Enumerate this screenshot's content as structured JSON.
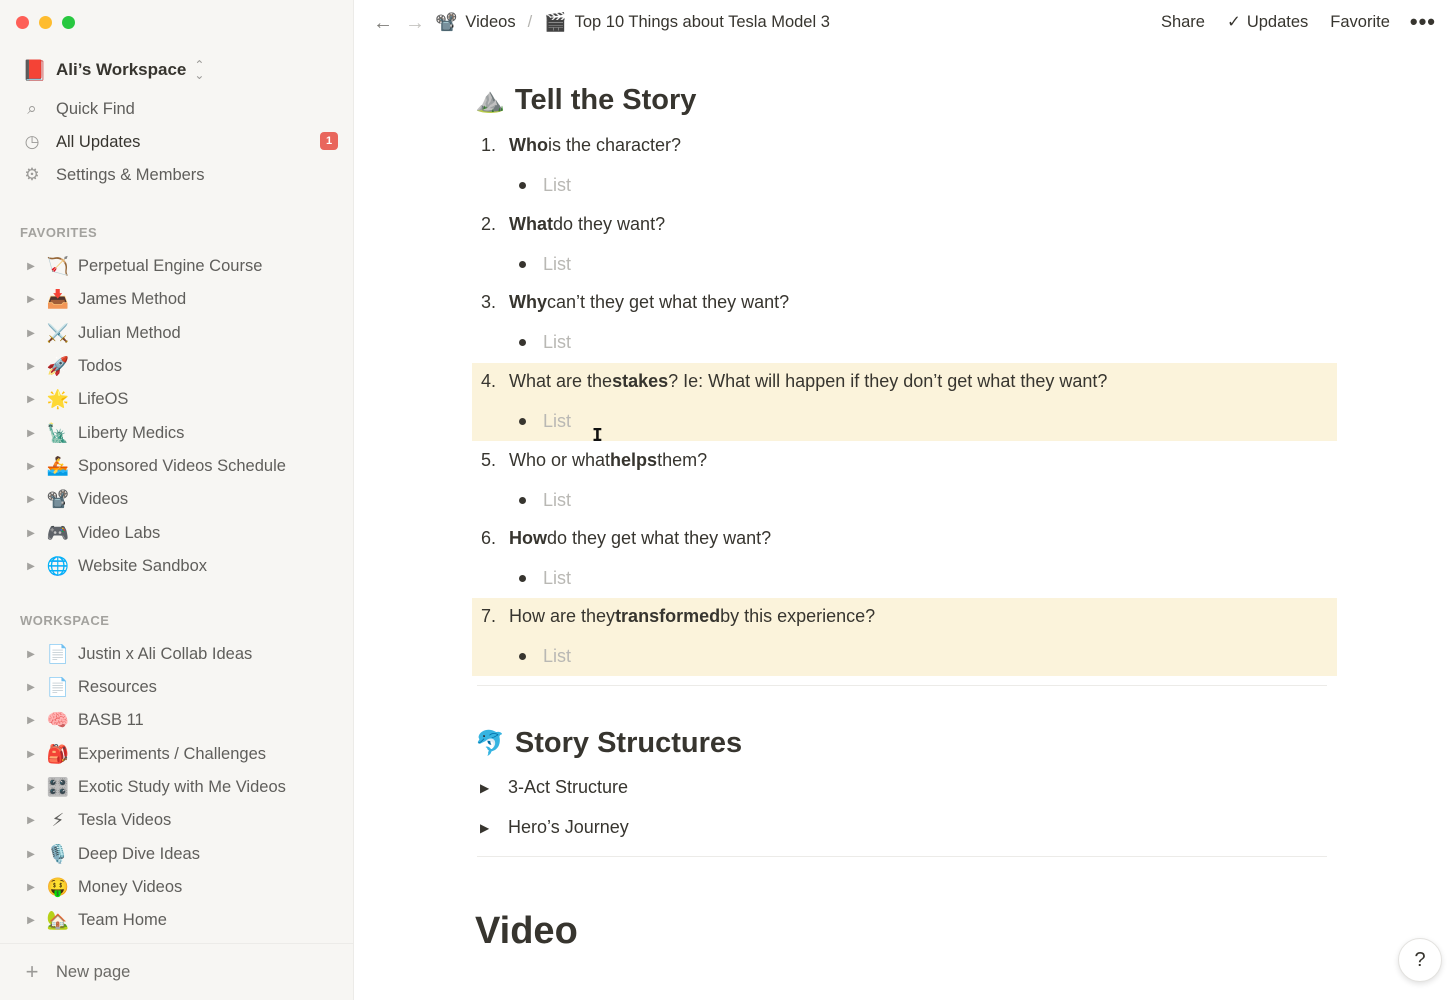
{
  "sidebar": {
    "workspace": {
      "icon": "📕",
      "name": "Ali’s Workspace",
      "switch_icon": "⌃⌄"
    },
    "top_items": [
      {
        "icon": "🔍",
        "label": "Quick Find"
      },
      {
        "icon": "🕒",
        "label": "All Updates",
        "badge": "1"
      },
      {
        "icon": "⚙",
        "label": "Settings & Members"
      }
    ],
    "favorites_label": "FAVORITES",
    "favorites": [
      {
        "emoji": "🏹",
        "label": "Perpetual Engine Course"
      },
      {
        "emoji": "📥",
        "label": "James Method"
      },
      {
        "emoji": "⚔️",
        "label": "Julian Method"
      },
      {
        "emoji": "🚀",
        "label": "Todos"
      },
      {
        "emoji": "🌟",
        "label": "LifeOS"
      },
      {
        "emoji": "🗽",
        "label": "Liberty Medics"
      },
      {
        "emoji": "🚣",
        "label": "Sponsored Videos Schedule"
      },
      {
        "emoji": "📽️",
        "label": "Videos"
      },
      {
        "emoji": "🎮",
        "label": "Video Labs"
      },
      {
        "emoji": "🌐",
        "label": "Website Sandbox"
      }
    ],
    "workspace_label": "WORKSPACE",
    "workspace_items": [
      {
        "emoji": "📄",
        "label": "Justin x Ali Collab Ideas"
      },
      {
        "emoji": "📄",
        "label": "Resources"
      },
      {
        "emoji": "🧠",
        "label": "BASB 11"
      },
      {
        "emoji": "🎒",
        "label": "Experiments / Challenges"
      },
      {
        "emoji": "🎛️",
        "label": "Exotic Study with Me Videos"
      },
      {
        "emoji": "⚡",
        "label": "Tesla Videos"
      },
      {
        "emoji": "🎙️",
        "label": "Deep Dive Ideas"
      },
      {
        "emoji": "🤑",
        "label": "Money Videos"
      },
      {
        "emoji": "🏡",
        "label": "Team Home"
      }
    ],
    "new_page": "New page"
  },
  "topbar": {
    "breadcrumbs": [
      {
        "emoji": "📽️",
        "label": "Videos"
      },
      {
        "emoji": "🎬",
        "label": "Top 10 Things about Tesla Model 3"
      }
    ],
    "separator": "/",
    "share": "Share",
    "updates": "Updates",
    "favorite": "Favorite",
    "more": "•••"
  },
  "content": {
    "section1": {
      "emoji": "⛰️",
      "title": "Tell the Story"
    },
    "questions": [
      {
        "num": "1.",
        "bold": "Who",
        "rest": " is the character?",
        "bullet": "List"
      },
      {
        "num": "2.",
        "bold": "What",
        "rest": " do they want?",
        "bullet": "List"
      },
      {
        "num": "3.",
        "bold": "Why",
        "rest": " can’t they get what they want?",
        "bullet": "List"
      },
      {
        "num": "4.",
        "pre": "What are the ",
        "bold": "stakes",
        "rest": "? Ie: What will happen if they don’t get what they want?",
        "bullet": "List"
      },
      {
        "num": "5.",
        "pre": "Who or what ",
        "bold": "helps",
        "rest": " them?",
        "bullet": "List"
      },
      {
        "num": "6.",
        "bold": "How",
        "rest": " do they get what they want?",
        "bullet": "List"
      },
      {
        "num": "7.",
        "pre": "How are they ",
        "bold": "transformed",
        "rest": " by this experience?",
        "bullet": "List"
      }
    ],
    "section2": {
      "emoji": "🐬",
      "title": "Story Structures"
    },
    "toggles": [
      "3-Act Structure",
      "Hero’s Journey"
    ],
    "heading1": "Video",
    "help": "?"
  }
}
